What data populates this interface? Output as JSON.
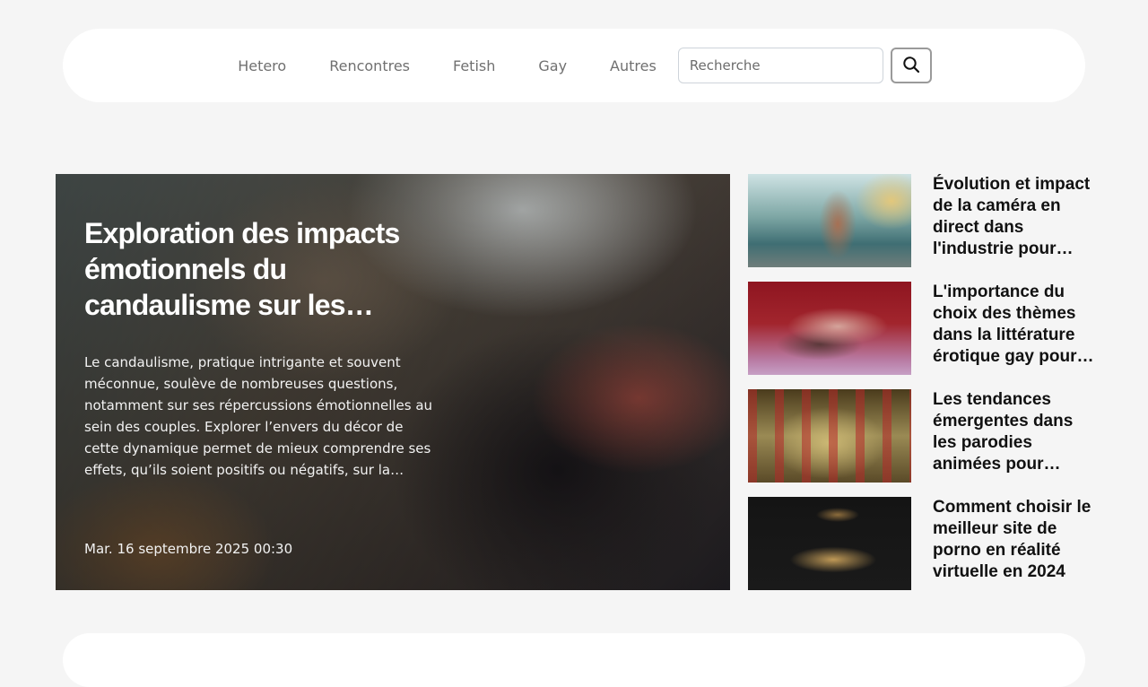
{
  "nav": {
    "links": [
      "Hetero",
      "Rencontres",
      "Fetish",
      "Gay",
      "Autres"
    ],
    "search_placeholder": "Recherche",
    "search_value": "",
    "search_icon": "magnifier-icon"
  },
  "hero": {
    "title": "Exploration des impacts émotionnels du candaulisme sur les couples",
    "excerpt": "Le candaulisme, pratique intrigante et souvent méconnue, soulève de nombreuses questions, notamment sur ses répercussions émotionnelles au sein des couples. Explorer l’envers du décor de cette dynamique permet de mieux comprendre ses effets, qu’ils soient positifs ou négatifs, sur la relation et",
    "date": "Mar. 16 septembre 2025 00:30"
  },
  "sidebar": {
    "items": [
      {
        "title": "Évolution et impact de la caméra en direct dans l'industrie pour adultes"
      },
      {
        "title": "L'importance du choix des thèmes dans la littérature érotique gay pour un"
      },
      {
        "title": "Les tendances émergentes dans les parodies animées pour adultes"
      },
      {
        "title": "Comment choisir le meilleur site de porno en réalité virtuelle en 2024"
      }
    ]
  }
}
